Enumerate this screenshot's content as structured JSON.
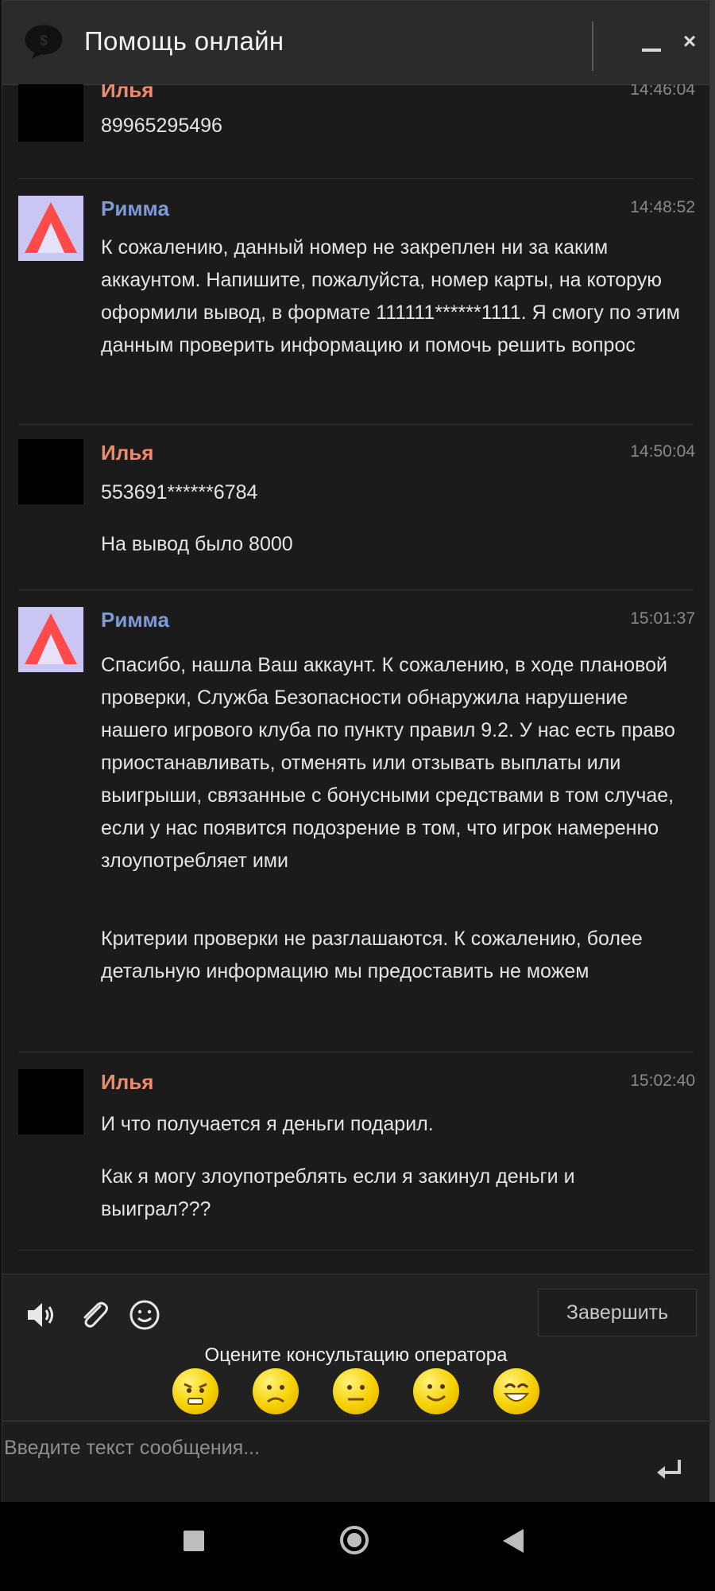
{
  "window": {
    "title": "Помощь онлайн",
    "logo_icon": "chat-dollar-icon",
    "minimize_icon": "minimize-icon",
    "close_label": "×"
  },
  "colors": {
    "user_name": "#f08a6c",
    "operator_name": "#7f9ad6",
    "background": "#1b1b1b",
    "rating_face": "#f5d000"
  },
  "messages": [
    {
      "author": "Илья",
      "role": "user",
      "time": "14:46:04",
      "paragraphs": [
        "89965295496"
      ]
    },
    {
      "author": "Римма",
      "role": "operator",
      "time": "14:48:52",
      "paragraphs": [
        "К сожалению, данный номер не закреплен ни за каким аккаунтом. Напишите, пожалуйста, номер карты, на которую оформили вывод, в формате 111111******1111. Я смогу по этим данным проверить информацию и помочь решить вопрос"
      ]
    },
    {
      "author": "Илья",
      "role": "user",
      "time": "14:50:04",
      "paragraphs": [
        "553691******6784",
        "На вывод было 8000"
      ]
    },
    {
      "author": "Римма",
      "role": "operator",
      "time": "15:01:37",
      "paragraphs": [
        "Спасибо, нашла Ваш аккаунт. К сожалению, в ходе плановой проверки, Служба Безопасности обнаружила нарушение нашего игрового клуба по пункту правил 9.2. У нас есть право приостанавливать, отменять или отзывать выплаты или выигрыши, связанные с бонусными средствами в том случае, если у нас появится подозрение в том, что игрок намеренно злоупотребляет ими",
        "Критерии проверки не разглашаются. К сожалению, более детальную информацию мы предоставить не можем"
      ]
    },
    {
      "author": "Илья",
      "role": "user",
      "time": "15:02:40",
      "paragraphs": [
        "И что получается я деньги подарил.",
        "Как я могу злоупотреблять если я закинул деньги и выиграл???"
      ]
    }
  ],
  "toolbar": {
    "sound_icon": "speaker-icon",
    "attach_icon": "paperclip-icon",
    "emoji_icon": "smiley-icon",
    "finish_label": "Завершить",
    "rating_label": "Оцените консультацию оператора",
    "rating_faces": [
      "angry",
      "sad",
      "neutral",
      "happy",
      "delighted"
    ]
  },
  "input": {
    "placeholder": "Введите текст сообщения...",
    "value": "",
    "send_icon": "enter-icon"
  },
  "navbar": {
    "recents_icon": "square-icon",
    "home_icon": "circle-icon",
    "back_icon": "triangle-back-icon"
  }
}
